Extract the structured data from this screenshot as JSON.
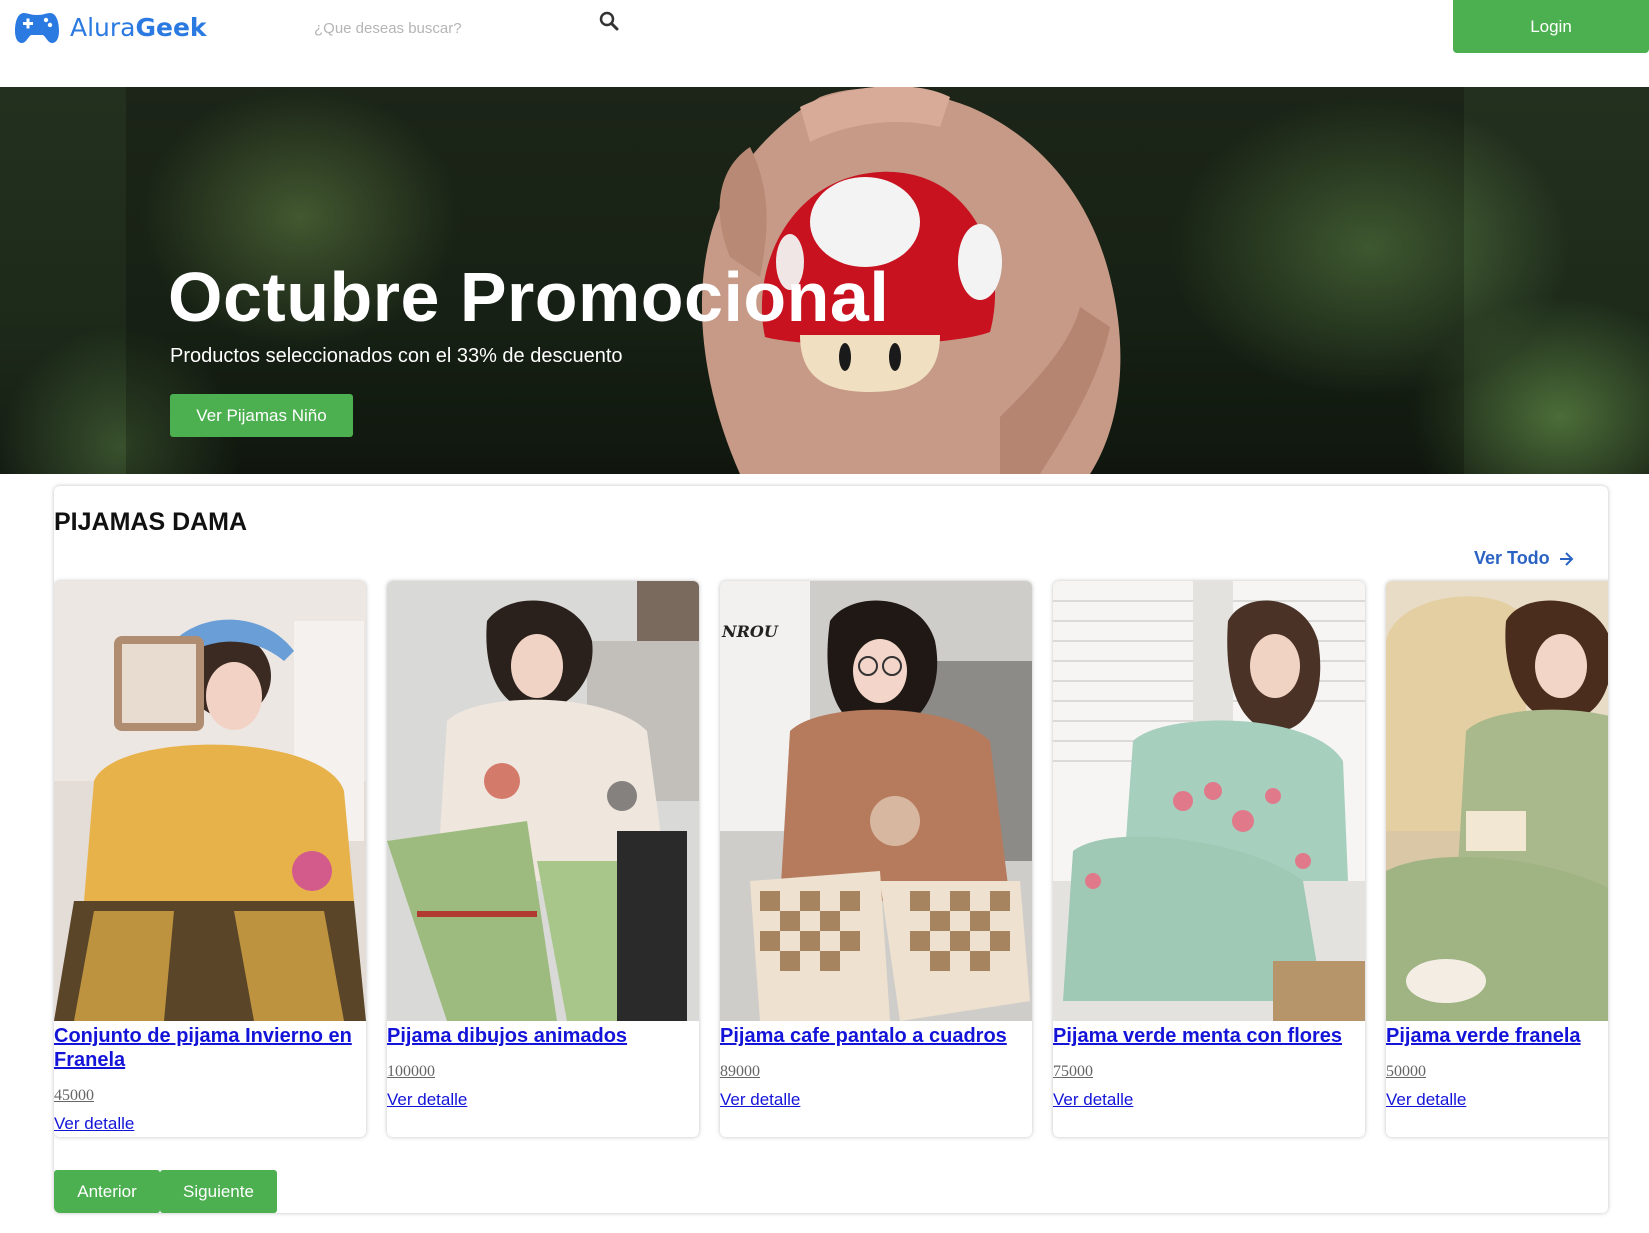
{
  "brand": {
    "name_part1": "Alura",
    "name_part2": "Geek",
    "accent_color": "#2a7ae2"
  },
  "search": {
    "placeholder": "¿Que deseas buscar?",
    "icon": "search-icon"
  },
  "header": {
    "login_label": "Login",
    "button_color": "#4caf50"
  },
  "hero": {
    "title": "Octubre Promocional",
    "subtitle": "Productos seleccionados con el 33% de descuento",
    "button_label": "Ver Pijamas Niño"
  },
  "section": {
    "title": "PIJAMAS DAMA",
    "view_all_label": "Ver Todo",
    "view_all_icon": "arrow-right-icon"
  },
  "products": [
    {
      "title": "Conjunto de pijama Invierno en Franela",
      "price": "45000",
      "link": "Ver detalle"
    },
    {
      "title": "Pijama dibujos animados",
      "price": "100000",
      "link": "Ver detalle"
    },
    {
      "title": "Pijama cafe pantalo a cuadros",
      "price": "89000",
      "link": "Ver detalle"
    },
    {
      "title": "Pijama verde menta con flores",
      "price": "75000",
      "link": "Ver detalle"
    },
    {
      "title": "Pijama verde franela",
      "price": "50000",
      "link": "Ver detalle"
    }
  ],
  "pagination": {
    "prev_label": "Anterior",
    "next_label": "Siguiente"
  }
}
